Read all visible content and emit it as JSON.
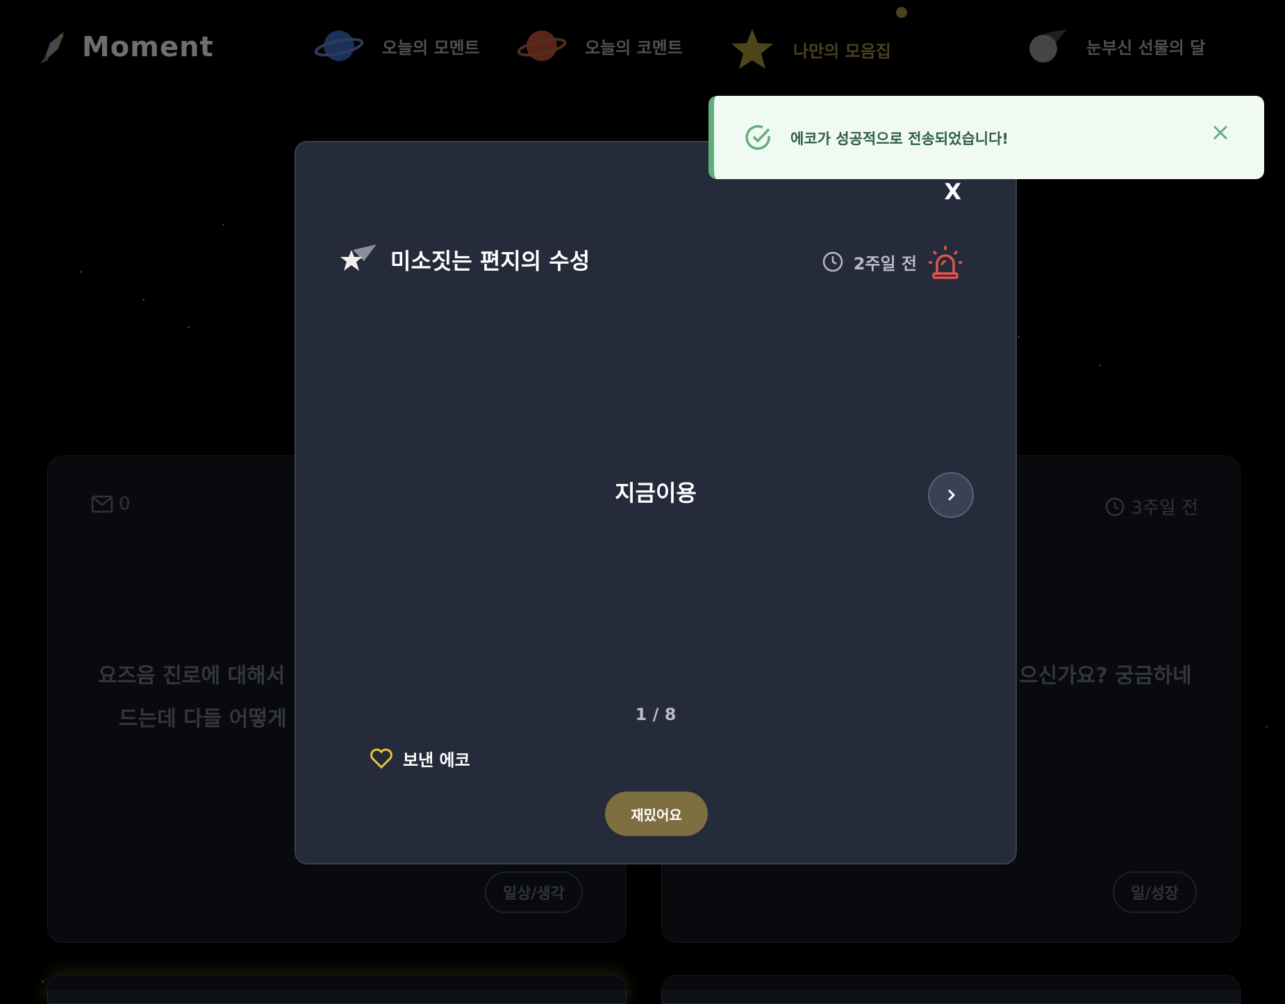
{
  "nav": {
    "logo": "Moment",
    "items": [
      {
        "label": "오늘의 모멘트",
        "icon": "blue-planet-icon"
      },
      {
        "label": "오늘의 코멘트",
        "icon": "red-planet-icon"
      },
      {
        "label": "나만의 모음집",
        "icon": "star-icon",
        "active": true
      },
      {
        "label": "눈부신 선물의 달",
        "icon": "moon-icon"
      }
    ]
  },
  "bg_cards": [
    {
      "comment_count": "0",
      "text_line1": "요즈음 진로에 대해서",
      "text_line2": "드는데 다들 어떻게",
      "tag": "일상/생각"
    },
    {
      "time": "3주일 전",
      "text_line1": "으신가요? 궁금하네",
      "tag": "일/성장"
    }
  ],
  "modal": {
    "close_label": "X",
    "title": "미소짓는 편지의 수성",
    "time": "2주일 전",
    "body": "지금이용",
    "pager": "1 / 8",
    "echo_label": "보낸 에코",
    "fun_button": "재밌어요"
  },
  "toast": {
    "message": "에코가 성공적으로 전송되었습니다!"
  },
  "colors": {
    "modal_bg": "#252b3b",
    "accent_gold": "#7d6f3f",
    "toast_bg": "#f0faf3",
    "toast_accent": "#5fae7d",
    "siren_red": "#e0554f"
  }
}
